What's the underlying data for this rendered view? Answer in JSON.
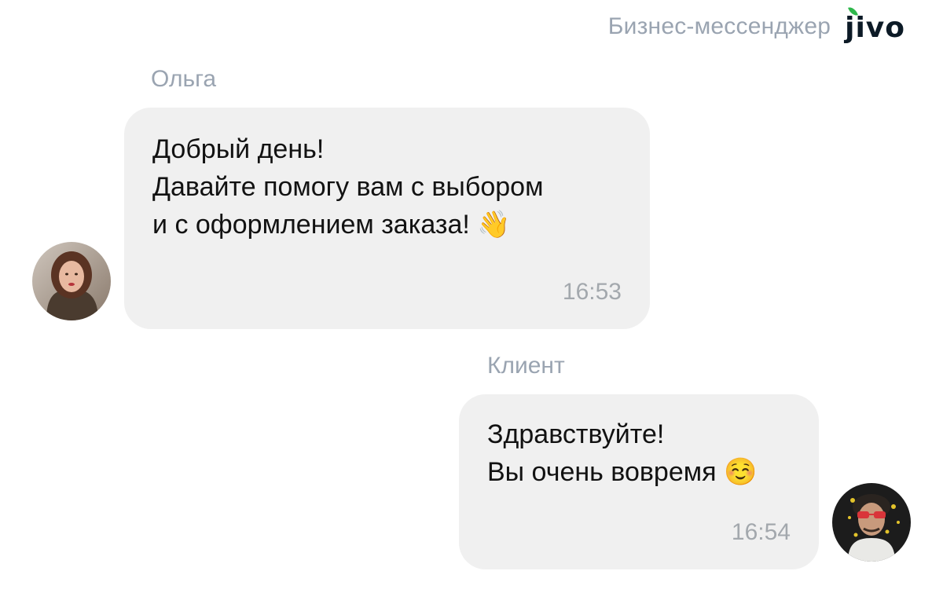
{
  "header": {
    "tagline": "Бизнес-мессенджер",
    "logo_text": "jivo",
    "logo_leaf_color": "#2eb74b"
  },
  "messages": [
    {
      "sender": "Ольга",
      "lines": [
        "Добрый день!",
        "Давайте помогу вам с выбором",
        "и с оформлением заказа!"
      ],
      "emoji": "👋",
      "time": "16:53",
      "avatar": "agent-avatar"
    },
    {
      "sender": "Клиент",
      "lines": [
        "Здравствуйте!",
        "Вы очень вовремя"
      ],
      "emoji": "☺️",
      "time": "16:54",
      "avatar": "client-avatar"
    }
  ],
  "colors": {
    "bubble_bg": "#f0f0f0",
    "name_text": "#9aa4b1",
    "time_text": "#a3a8ad"
  }
}
